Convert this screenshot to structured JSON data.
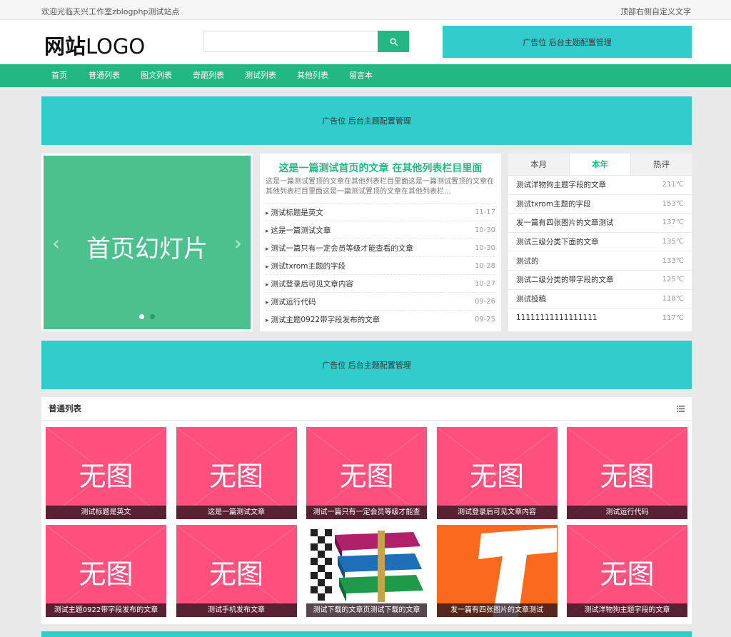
{
  "topbar": {
    "welcome": "欢迎光临天兴工作室zblogphp测试站点",
    "right_text": "顶部右侧自定义文字"
  },
  "header": {
    "logo_cn": "网站",
    "logo_en": "LOGO",
    "search": {
      "placeholder": "",
      "value": ""
    },
    "ad_text": "广告位 后台主题配置管理"
  },
  "nav": {
    "items": [
      "首页",
      "普通列表",
      "图文列表",
      "奇葩列表",
      "测试列表",
      "其他列表",
      "留言本"
    ]
  },
  "ads": {
    "banner1": "广告位 后台主题配置管理",
    "banner2": "广告位 后台主题配置管理"
  },
  "slider": {
    "title": "首页幻灯片",
    "prev": "‹",
    "next": "›",
    "dots_count": 2,
    "active_dot": 1
  },
  "featured": {
    "headline": "这是一篇测试首页的文章 在其他列表栏目里面",
    "summary": "这是一篇测试置顶的文章在其他列表栏目里面这是一篇测试置顶的文章在其他列表栏目里面这是一篇测试置顶的文章在其他列表栏...",
    "list": [
      {
        "title": "测试标题是英文",
        "date": "11-17"
      },
      {
        "title": "这是一篇测试文章",
        "date": "10-30"
      },
      {
        "title": "测试一篇只有一定会员等级才能查看的文章",
        "date": "10-30"
      },
      {
        "title": "测试txrom主题的字段",
        "date": "10-28"
      },
      {
        "title": "测试登录后可见文章内容",
        "date": "10-27"
      },
      {
        "title": "测试运行代码",
        "date": "09-26"
      },
      {
        "title": "测试主题0922带字段发布的文章",
        "date": "09-25"
      }
    ]
  },
  "rank": {
    "tabs": [
      "本月",
      "本年",
      "热评"
    ],
    "active_tab": 1,
    "rows": [
      {
        "title": "测试洋物狗主题字段的文章",
        "value": "211℃"
      },
      {
        "title": "测试txrom主题的字段",
        "value": "153℃"
      },
      {
        "title": "发一篇有四张图片的文章测试",
        "value": "137℃"
      },
      {
        "title": "测试三级分类下面的文章",
        "value": "135℃"
      },
      {
        "title": "测试的",
        "value": "133℃"
      },
      {
        "title": "测试二级分类的带字段的文章",
        "value": "125℃"
      },
      {
        "title": "测试投稿",
        "value": "118℃"
      },
      {
        "title": "11111111111111111",
        "value": "117℃"
      }
    ]
  },
  "section": {
    "title": "普通列表",
    "placeholder_text": "无图",
    "cards": [
      {
        "caption": "测试标题是英文",
        "image": "noimg"
      },
      {
        "caption": "这是一篇测试文章",
        "image": "noimg"
      },
      {
        "caption": "测试一篇只有一定会员等级才能查",
        "image": "noimg"
      },
      {
        "caption": "测试登录后可见文章内容",
        "image": "noimg"
      },
      {
        "caption": "测试运行代码",
        "image": "noimg"
      },
      {
        "caption": "测试主题0922带字段发布的文章",
        "image": "noimg"
      },
      {
        "caption": "测试手机发布文章",
        "image": "noimg"
      },
      {
        "caption": "测试下载的文章页测试下载的文章",
        "image": "rar-books-icon"
      },
      {
        "caption": "发一篇有四张图片的文章测试",
        "image": "tapd-logo"
      },
      {
        "caption": "测试洋物狗主题字段的文章",
        "image": "noimg"
      }
    ]
  },
  "colors": {
    "primary": "#23b883",
    "ad": "#33cccc",
    "noimg": "#ff4f7d",
    "slider": "#4cc18e"
  }
}
